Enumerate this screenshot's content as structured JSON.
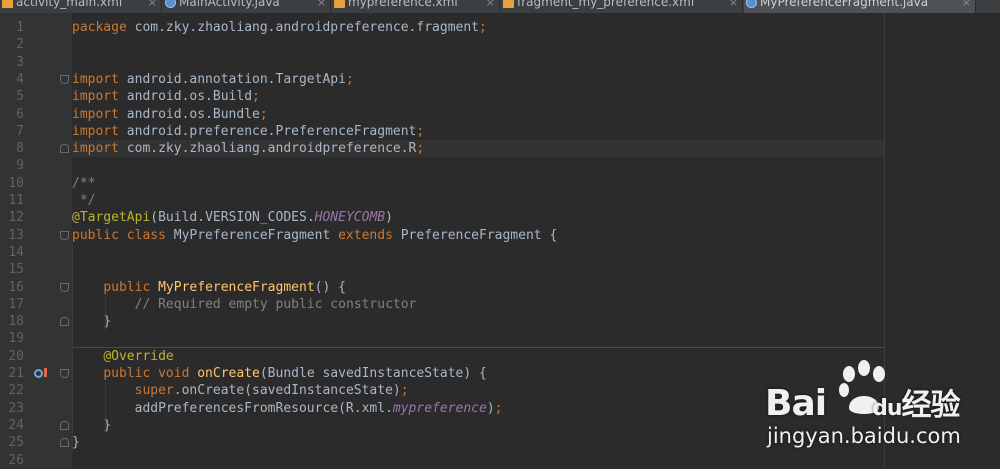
{
  "tabs": [
    {
      "label": "activity_main.xml",
      "type": "xml",
      "active": false
    },
    {
      "label": "MainActivity.java",
      "type": "java",
      "active": false
    },
    {
      "label": "mypreference.xml",
      "type": "xml",
      "active": false
    },
    {
      "label": "fragment_my_preference.xml",
      "type": "xml",
      "active": false
    },
    {
      "label": "MyPreferenceFragment.java",
      "type": "java",
      "active": true
    }
  ],
  "tab_close_glyph": "×",
  "editor": {
    "caret_line": 8,
    "lines": [
      {
        "n": "1",
        "tokens": [
          {
            "t": "package",
            "c": "kw"
          },
          {
            "t": " com.zky.zhaoliang.androidpreference.fragment"
          },
          {
            "t": ";",
            "c": "kw"
          }
        ]
      },
      {
        "n": "2",
        "tokens": []
      },
      {
        "n": "3",
        "tokens": []
      },
      {
        "n": "4",
        "tokens": [
          {
            "t": "import",
            "c": "kw"
          },
          {
            "t": " android.annotation.TargetApi"
          },
          {
            "t": ";",
            "c": "kw"
          }
        ]
      },
      {
        "n": "5",
        "tokens": [
          {
            "t": "import",
            "c": "kw"
          },
          {
            "t": " android.os.Build"
          },
          {
            "t": ";",
            "c": "kw"
          }
        ]
      },
      {
        "n": "6",
        "tokens": [
          {
            "t": "import",
            "c": "kw"
          },
          {
            "t": " android.os.Bundle"
          },
          {
            "t": ";",
            "c": "kw"
          }
        ]
      },
      {
        "n": "7",
        "tokens": [
          {
            "t": "import",
            "c": "kw"
          },
          {
            "t": " android.preference.PreferenceFragment"
          },
          {
            "t": ";",
            "c": "kw"
          }
        ]
      },
      {
        "n": "8",
        "tokens": [
          {
            "t": "import",
            "c": "kw"
          },
          {
            "t": " com.zky.zhaoliang.androidpreference.R"
          },
          {
            "t": ";",
            "c": "kw"
          }
        ]
      },
      {
        "n": "9",
        "tokens": []
      },
      {
        "n": "10",
        "tokens": [
          {
            "t": "/**",
            "c": "cmt"
          }
        ]
      },
      {
        "n": "11",
        "tokens": [
          {
            "t": " */",
            "c": "cmt"
          }
        ]
      },
      {
        "n": "12",
        "tokens": [
          {
            "t": "@TargetApi",
            "c": "ann"
          },
          {
            "t": "(Build.VERSION_CODES."
          },
          {
            "t": "HONEYCOMB",
            "c": "it"
          },
          {
            "t": ")"
          }
        ]
      },
      {
        "n": "13",
        "tokens": [
          {
            "t": "public class",
            "c": "kw"
          },
          {
            "t": " MyPreferenceFragment "
          },
          {
            "t": "extends",
            "c": "kw"
          },
          {
            "t": " PreferenceFragment {"
          }
        ]
      },
      {
        "n": "14",
        "tokens": []
      },
      {
        "n": "15",
        "tokens": []
      },
      {
        "n": "16",
        "tokens": [
          {
            "t": "    "
          },
          {
            "t": "public",
            "c": "kw"
          },
          {
            "t": " "
          },
          {
            "t": "MyPreferenceFragment",
            "c": "fn"
          },
          {
            "t": "() {"
          }
        ]
      },
      {
        "n": "17",
        "tokens": [
          {
            "t": "        "
          },
          {
            "t": "// Required empty public constructor",
            "c": "cmt"
          }
        ]
      },
      {
        "n": "18",
        "tokens": [
          {
            "t": "    }"
          }
        ]
      },
      {
        "n": "19",
        "tokens": []
      },
      {
        "n": "20",
        "tokens": [
          {
            "t": "    "
          },
          {
            "t": "@Override",
            "c": "ann"
          }
        ]
      },
      {
        "n": "21",
        "tokens": [
          {
            "t": "    "
          },
          {
            "t": "public void",
            "c": "kw"
          },
          {
            "t": " "
          },
          {
            "t": "onCreate",
            "c": "fn"
          },
          {
            "t": "(Bundle savedInstanceState) {"
          }
        ]
      },
      {
        "n": "22",
        "tokens": [
          {
            "t": "        "
          },
          {
            "t": "super",
            "c": "kw"
          },
          {
            "t": ".onCreate(savedInstanceState)"
          },
          {
            "t": ";",
            "c": "kw"
          }
        ]
      },
      {
        "n": "23",
        "tokens": [
          {
            "t": "        addPreferencesFromResource(R.xml."
          },
          {
            "t": "mypreference",
            "c": "it"
          },
          {
            "t": ")"
          },
          {
            "t": ";",
            "c": "kw"
          }
        ]
      },
      {
        "n": "24",
        "tokens": [
          {
            "t": "    }"
          }
        ]
      },
      {
        "n": "25",
        "tokens": [
          {
            "t": "}"
          }
        ]
      },
      {
        "n": "26",
        "tokens": []
      }
    ]
  },
  "gutter_markers": {
    "fold_open_lines": [
      4,
      13,
      16,
      21
    ],
    "fold_close_lines": [
      8,
      18,
      24,
      25
    ],
    "override_line": 21
  },
  "watermark": {
    "main": "Bai",
    "main_suffix": "du",
    "main_cn": "经验",
    "sub": "jingyan.baidu.com",
    "icon": "paw-icon"
  },
  "colors": {
    "background": "#2b2b2b",
    "gutter": "#313335",
    "keyword": "#cc7832",
    "annotation": "#bbb529",
    "comment": "#808080",
    "method": "#ffc66d",
    "constant": "#9876aa",
    "text": "#a9b7c6"
  }
}
